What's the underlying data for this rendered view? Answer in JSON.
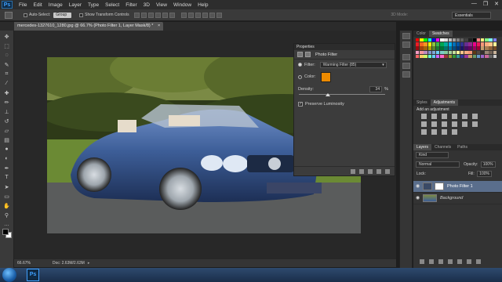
{
  "app": {
    "logo": "Ps",
    "menu": [
      "File",
      "Edit",
      "Image",
      "Layer",
      "Type",
      "Select",
      "Filter",
      "3D",
      "View",
      "Window",
      "Help"
    ],
    "window_controls": [
      "—",
      "❐",
      "✕"
    ]
  },
  "options_bar": {
    "auto_select_label": "Auto-Select:",
    "auto_select_value": "Group",
    "show_transform_label": "Show Transform Controls",
    "mode_3d": "3D Mode:",
    "workspace": "Essentials"
  },
  "document": {
    "tab_title": "mercedes-1327610_1280.jpg @ 66.7% (Photo Filter 1, Layer Mask/8) *",
    "tab_close": "×",
    "zoom": "66.67%",
    "doc_info": "Doc: 2.63M/2.63M"
  },
  "properties": {
    "panel_title": "Properties",
    "subtitle": "Photo Filter",
    "filter_label": "Filter:",
    "filter_value": "Warming Filter (85)",
    "color_label": "Color:",
    "color_hex": "#ec8a00",
    "density_label": "Density:",
    "density_value": "34",
    "density_unit": "%",
    "density_level": 0.34,
    "preserve_label": "Preserve Luminosity",
    "preserve_checked": true
  },
  "right_panels": {
    "color_tabs": [
      "Color",
      "Swatches"
    ],
    "adj_tabs": [
      "Styles",
      "Adjustments"
    ],
    "add_adjustment": "Add an adjustment",
    "layer_tabs": [
      "Layers",
      "Channels",
      "Paths"
    ],
    "kind_label": "Kind",
    "blend_mode": "Normal",
    "opacity_label": "Opacity:",
    "opacity_value": "100%",
    "lock_label": "Lock:",
    "fill_label": "Fill:",
    "fill_value": "100%",
    "layers": [
      {
        "name": "Photo Filter 1",
        "selected": true
      },
      {
        "name": "Background",
        "selected": false
      }
    ]
  },
  "swatch_colors": [
    "#ff0000",
    "#ffff00",
    "#00ff00",
    "#00ffff",
    "#0000ff",
    "#ff00ff",
    "#ffffff",
    "#e0e0e0",
    "#c0c0c0",
    "#a0a0a0",
    "#808080",
    "#606060",
    "#404040",
    "#202020",
    "#000000",
    "#ff8080",
    "#ffff80",
    "#80ff80",
    "#80ffff",
    "#8080ff",
    "#ed1c24",
    "#f26522",
    "#f7941d",
    "#fff200",
    "#8dc63f",
    "#39b54a",
    "#00a651",
    "#00a99d",
    "#00aeef",
    "#0072bc",
    "#0054a6",
    "#2e3192",
    "#662d91",
    "#92278f",
    "#ec008c",
    "#ed145b",
    "#f69679",
    "#f9ad81",
    "#fdc689",
    "#fff799",
    "#9e0b0f",
    "#a0410d",
    "#a36209",
    "#aba000",
    "#598527",
    "#1a7b30",
    "#007236",
    "#00746b",
    "#0076a3",
    "#004b80",
    "#003471",
    "#1b1464",
    "#440e62",
    "#630460",
    "#9e005d",
    "#9e0039",
    "#c69c6d",
    "#a67c52",
    "#8c6239",
    "#754c24",
    "#f49ac1",
    "#f5989d",
    "#bd8cbf",
    "#8393ca",
    "#7ea7d8",
    "#6dcff6",
    "#7accc8",
    "#82ca9c",
    "#a3d39c",
    "#c4df9b",
    "#fff79a",
    "#fdc68a",
    "#f9ad81",
    "#f69679",
    "#603913",
    "#534741",
    "#362f2d",
    "#998675",
    "#736357",
    "#c7b299",
    "#ff6666",
    "#ffcc66",
    "#ccff66",
    "#66ffcc",
    "#66ccff",
    "#cc66ff",
    "#ff66cc",
    "#993333",
    "#999933",
    "#339933",
    "#339999",
    "#333399",
    "#993399",
    "#cc9966",
    "#669966",
    "#6699cc",
    "#9966cc",
    "#cc6699",
    "#666666",
    "#cccccc"
  ]
}
